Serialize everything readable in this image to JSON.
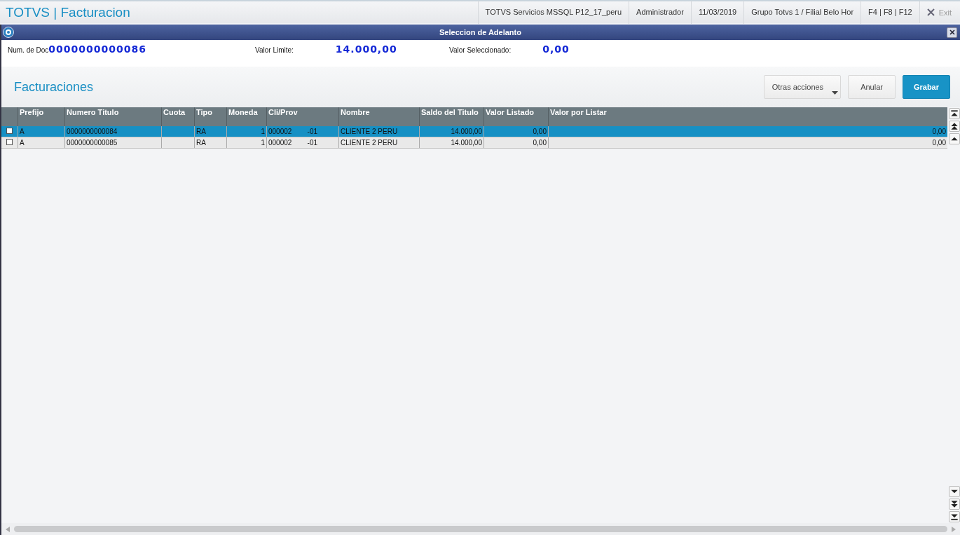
{
  "app": {
    "title": "TOTVS | Facturacion",
    "status_items": [
      "TOTVS Servicios MSSQL P12_17_peru",
      "Administrador",
      "11/03/2019",
      "Grupo Totvs 1 / Filial Belo Hor",
      "F4 | F8 | F12"
    ],
    "exit_label": "Exit"
  },
  "dialog": {
    "title": "Seleccion de Adelanto"
  },
  "fields": [
    {
      "label": "Num. de Doc",
      "value": "0000000000086"
    },
    {
      "label": "Valor Limite:",
      "value": "14.000,00"
    },
    {
      "label": "Valor Seleccionado:",
      "value": "0,00"
    }
  ],
  "section_title": "Facturaciones",
  "buttons": [
    {
      "label": "Otras acciones",
      "kind": "menu"
    },
    {
      "label": "Anular",
      "kind": "plain"
    },
    {
      "label": "Grabar",
      "kind": "primary"
    }
  ],
  "table": {
    "columns": [
      {
        "label": "Prefijo",
        "kind": "text"
      },
      {
        "label": "Numero Titulo",
        "kind": "text"
      },
      {
        "label": "Cuota",
        "kind": "text"
      },
      {
        "label": "Tipo",
        "kind": "text"
      },
      {
        "label": "Moneda",
        "kind": "number"
      },
      {
        "label": "Cli/Prov",
        "kind": "text"
      },
      {
        "label": "Nombre",
        "kind": "text"
      },
      {
        "label": "Saldo del Titulo",
        "kind": "number"
      },
      {
        "label": "Valor Listado",
        "kind": "number"
      },
      {
        "label": "Valor por Listar",
        "kind": "number"
      }
    ],
    "rows": [
      {
        "selected": true,
        "checked": false,
        "cells": [
          "A",
          "0000000000084",
          "",
          "RA",
          "1",
          "000002        -01",
          "CLIENTE 2 PERU",
          "14.000,00",
          "0,00",
          "0,00"
        ]
      },
      {
        "selected": false,
        "checked": false,
        "cells": [
          "A",
          "0000000000085",
          "",
          "RA",
          "1",
          "000002        -01",
          "CLIENTE 2 PERU",
          "14.000,00",
          "0,00",
          "0,00"
        ]
      }
    ]
  }
}
